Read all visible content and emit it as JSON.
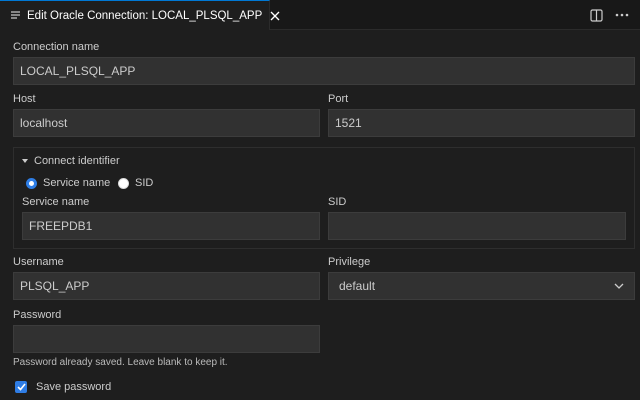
{
  "tab": {
    "title": "Edit Oracle Connection: LOCAL_PLSQL_APP",
    "icon": "lines-icon"
  },
  "actions": [
    "split-editor-icon",
    "more-actions-icon"
  ],
  "form": {
    "connection_name": {
      "label": "Connection name",
      "value": "LOCAL_PLSQL_APP"
    },
    "host": {
      "label": "Host",
      "value": "localhost"
    },
    "port": {
      "label": "Port",
      "value": "1521"
    },
    "connect_identifier": {
      "label": "Connect identifier",
      "options": [
        "Service name",
        "SID"
      ],
      "selected": "Service name",
      "service_name": {
        "label": "Service name",
        "value": "FREEPDB1"
      },
      "sid": {
        "label": "SID",
        "value": ""
      }
    },
    "username": {
      "label": "Username",
      "value": "PLSQL_APP"
    },
    "privilege": {
      "label": "Privilege",
      "value": "default"
    },
    "password": {
      "label": "Password",
      "value": "",
      "hint": "Password already saved. Leave blank to keep it."
    },
    "save_password": {
      "label": "Save password",
      "checked": true
    }
  },
  "colors": {
    "accent": "#2f7de5",
    "background": "#1e1e1e",
    "input": "#313131"
  }
}
